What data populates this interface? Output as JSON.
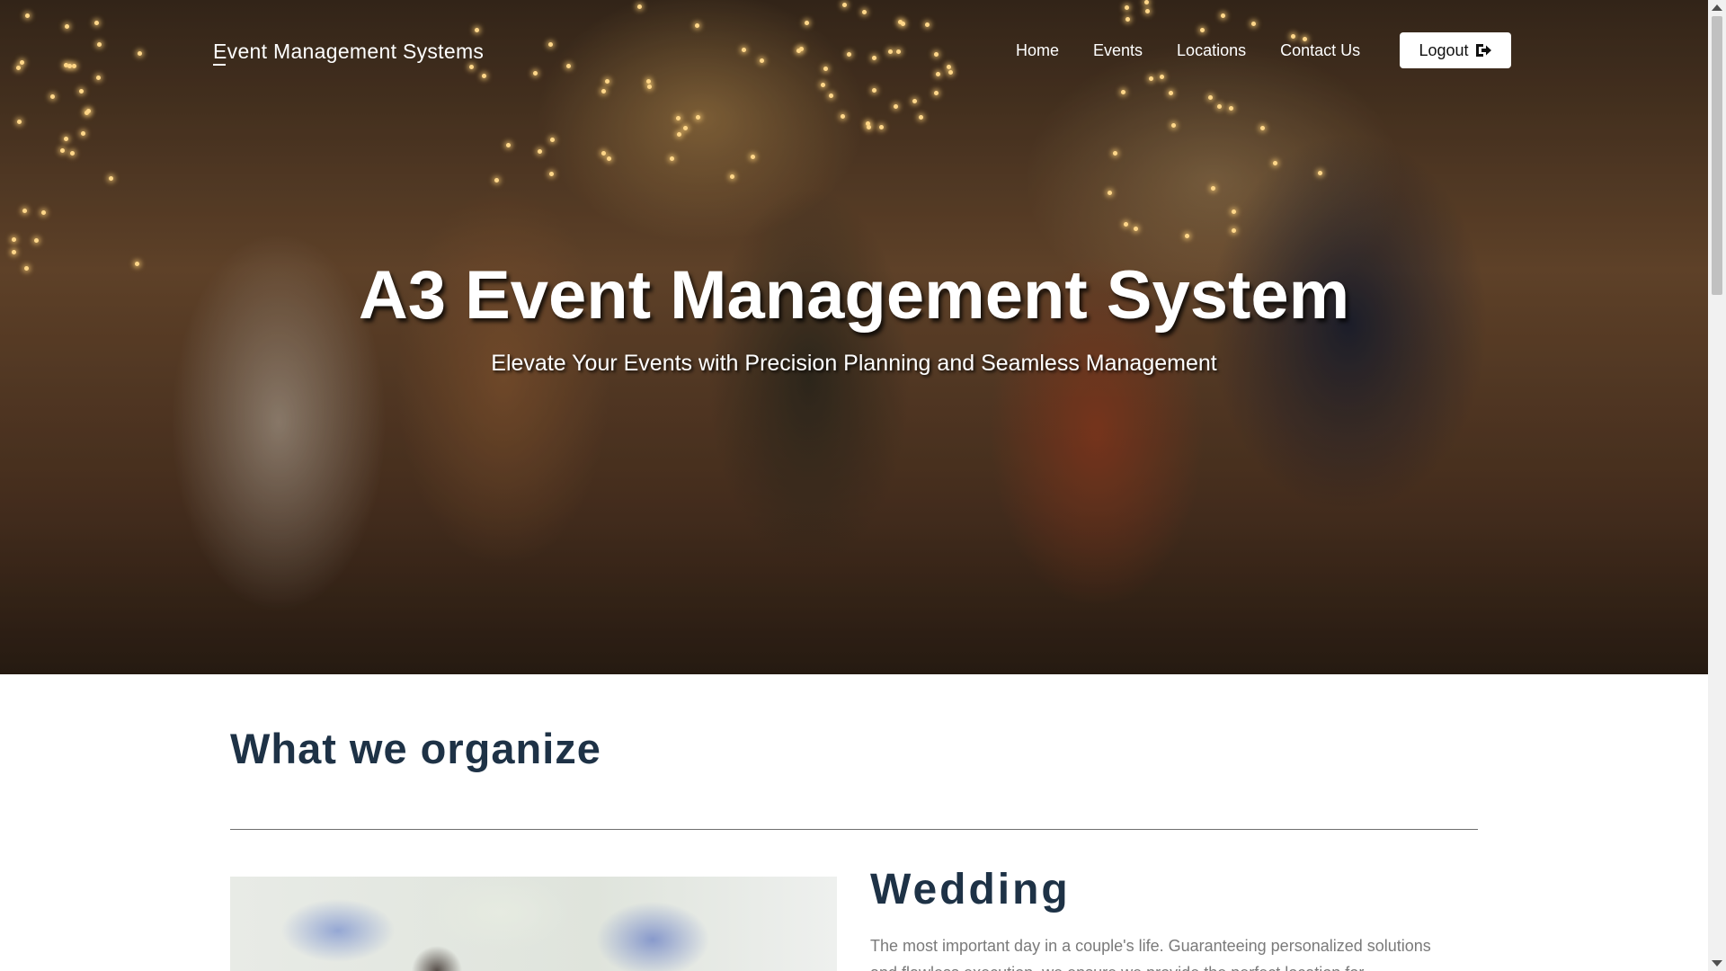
{
  "navbar": {
    "brand": "Event Management Systems",
    "links": [
      "Home",
      "Events",
      "Locations",
      "Contact Us"
    ],
    "logout_label": "Logout"
  },
  "hero": {
    "title": "A3 Event Management System",
    "subtitle": "Elevate Your Events with Precision Planning and Seamless Management"
  },
  "section": {
    "title": "What we organize"
  },
  "events": [
    {
      "title": "Wedding",
      "description": "The most important day in a couple's life. Guaranteeing personalized solutions and flawless execution, we ensure we provide the perfect location for"
    }
  ]
}
